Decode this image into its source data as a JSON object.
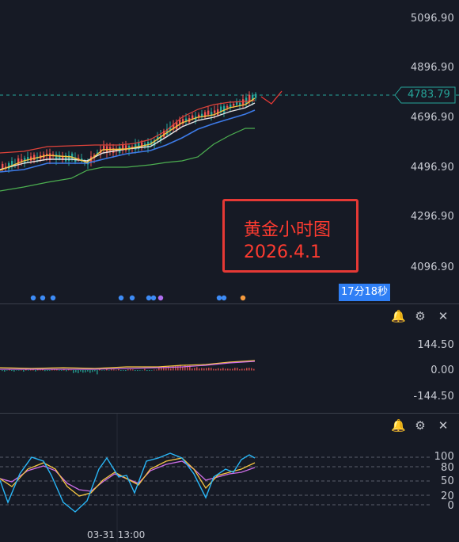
{
  "price_axis": {
    "ticks": [
      "5096.90",
      "4896.90",
      "4696.90",
      "4496.90",
      "4296.90",
      "4096.90"
    ]
  },
  "current_price": "4783.79",
  "annotation": {
    "line1": "黄金小时图",
    "line2": "2026.4.1"
  },
  "countdown": "17分18秒",
  "macd_axis": {
    "ticks": [
      "144.50",
      "0.00",
      "-144.50"
    ]
  },
  "osc_axis": {
    "ticks": [
      "100",
      "80",
      "50",
      "20",
      "0"
    ]
  },
  "time_axis": {
    "label": "03-31 13:00"
  },
  "pane_controls": {
    "icons": [
      "bell-icon",
      "gear-icon",
      "close-icon"
    ]
  },
  "colors": {
    "background": "#161a25",
    "up_candle": "#ef5350",
    "down_candle": "#26a69a",
    "price_tag": "#26a69a",
    "annotation": "#ff3b30",
    "countdown_bg": "#2f7ff5",
    "ma_yellow": "#f5c542",
    "ma_white": "#e6e6e6",
    "ma_blue": "#3d7be8",
    "band_upper": "#e0433a",
    "band_lower": "#4caf50",
    "osc_fast": "#29b6f6",
    "osc_mid": "#f5c542",
    "osc_slow": "#ce6ee8"
  }
}
